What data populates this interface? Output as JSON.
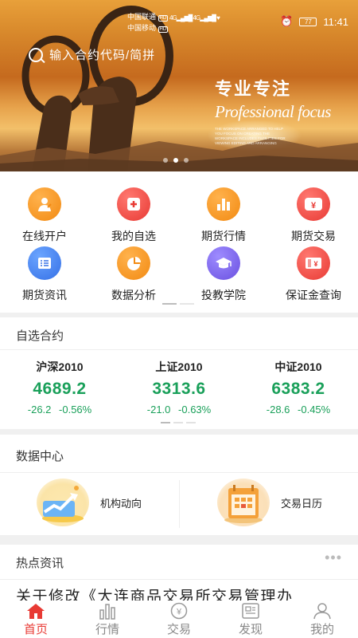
{
  "status_bar": {
    "carrier1": "中国联通",
    "carrier2": "中国移动",
    "badge1": "HD",
    "badge2": "HD",
    "net1": "4G",
    "net2": "4G",
    "battery": "77",
    "time": "11:41"
  },
  "search": {
    "placeholder": "输入合约代码/简拼"
  },
  "banner": {
    "slogan_cn": "专业专注",
    "slogan_en": "Professional focus",
    "fine_print": "THE WORKSPACE ARRANGED TO HELP YOU FOCUS ON CREATING THE WORKSPACE INCLUDES FACILITIES FOR VIEWING EDITING AND ARRANGING",
    "active_slide": 1,
    "slide_count": 3
  },
  "grid": [
    {
      "label": "在线开户",
      "icon": "open-account-icon",
      "color": "orange"
    },
    {
      "label": "我的自选",
      "icon": "favorites-plus-icon",
      "color": "red"
    },
    {
      "label": "期货行情",
      "icon": "bar-chart-icon",
      "color": "orange"
    },
    {
      "label": "期货交易",
      "icon": "yen-trade-icon",
      "color": "red"
    },
    {
      "label": "期货资讯",
      "icon": "news-list-icon",
      "color": "blue"
    },
    {
      "label": "数据分析",
      "icon": "pie-chart-icon",
      "color": "orange"
    },
    {
      "label": "投教学院",
      "icon": "graduation-cap-icon",
      "color": "purple"
    },
    {
      "label": "保证金查询",
      "icon": "yen-ticket-icon",
      "color": "red"
    }
  ],
  "watchlist": {
    "title": "自选合约",
    "quotes": [
      {
        "name": "沪深2010",
        "price": "4689.2",
        "change": "-26.2",
        "change_pct": "-0.56%"
      },
      {
        "name": "上证2010",
        "price": "3313.6",
        "change": "-21.0",
        "change_pct": "-0.63%"
      },
      {
        "name": "中证2010",
        "price": "6383.2",
        "change": "-28.6",
        "change_pct": "-0.45%"
      }
    ],
    "down_color": "#1aa05a"
  },
  "data_center": {
    "title": "数据中心",
    "items": [
      {
        "label": "机构动向",
        "icon": "trend-up-icon"
      },
      {
        "label": "交易日历",
        "icon": "calendar-icon"
      }
    ]
  },
  "hot_news": {
    "title": "热点资讯",
    "more": "•••",
    "headline": "关于修改《大连商品交易所交易管理办"
  },
  "tabbar": {
    "tabs": [
      {
        "label": "首页",
        "icon": "home-icon",
        "active": true
      },
      {
        "label": "行情",
        "icon": "market-bars-icon",
        "active": false
      },
      {
        "label": "交易",
        "icon": "yen-circle-icon",
        "active": false
      },
      {
        "label": "发现",
        "icon": "discover-icon",
        "active": false
      },
      {
        "label": "我的",
        "icon": "user-icon",
        "active": false
      }
    ],
    "active_color": "#e83a34"
  },
  "colors": {
    "accent": "#e83a34",
    "orange": "#f28a12",
    "blue": "#3570e6",
    "purple": "#6a50e0"
  }
}
